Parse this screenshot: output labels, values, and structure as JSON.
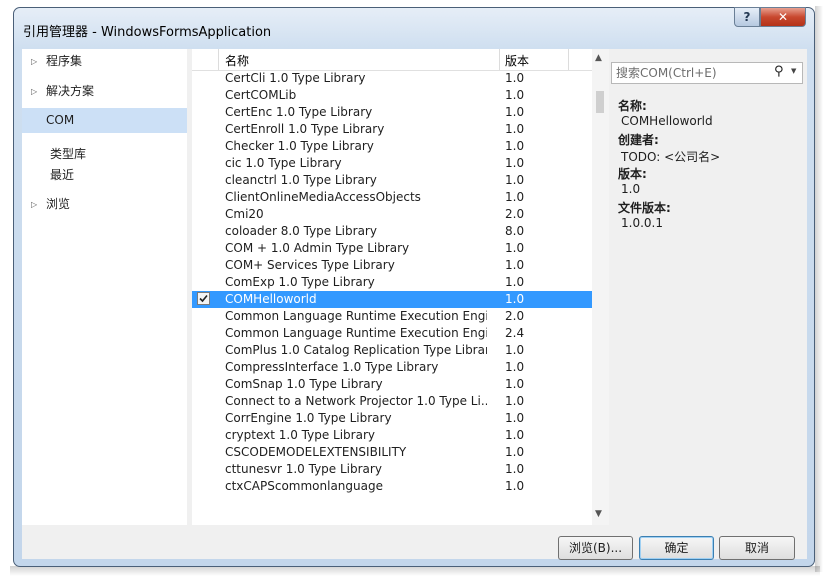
{
  "window": {
    "title": "引用管理器 - WindowsFormsApplication"
  },
  "titlebar": {
    "help_label": "?",
    "close_label": "✕"
  },
  "nav": {
    "items": [
      {
        "label": "程序集",
        "icon": "triangle-right-icon"
      },
      {
        "label": "解决方案",
        "icon": "triangle-right-icon"
      },
      {
        "label": "COM",
        "selected": true
      },
      {
        "label": "浏览",
        "icon": "triangle-right-icon"
      }
    ],
    "com_sub": [
      {
        "label": "类型库"
      },
      {
        "label": "最近"
      }
    ]
  },
  "list": {
    "columns": {
      "name": "名称",
      "version": "版本"
    },
    "rows": [
      {
        "name": "CertCli 1.0 Type Library",
        "version": "1.0"
      },
      {
        "name": "CertCOMLib",
        "version": "1.0"
      },
      {
        "name": "CertEnc 1.0 Type Library",
        "version": "1.0"
      },
      {
        "name": "CertEnroll 1.0 Type Library",
        "version": "1.0"
      },
      {
        "name": "Checker 1.0 Type Library",
        "version": "1.0"
      },
      {
        "name": "cic 1.0 Type Library",
        "version": "1.0"
      },
      {
        "name": "cleanctrl 1.0 Type Library",
        "version": "1.0"
      },
      {
        "name": "ClientOnlineMediaAccessObjects",
        "version": "1.0"
      },
      {
        "name": "Cmi20",
        "version": "2.0"
      },
      {
        "name": "coloader 8.0 Type Library",
        "version": "8.0"
      },
      {
        "name": "COM + 1.0 Admin Type Library",
        "version": "1.0"
      },
      {
        "name": "COM+ Services Type Library",
        "version": "1.0"
      },
      {
        "name": "ComExp 1.0 Type Library",
        "version": "1.0"
      },
      {
        "name": "COMHelloworld",
        "version": "1.0",
        "selected": true,
        "checked": true
      },
      {
        "name": "Common Language Runtime Execution Engi...",
        "version": "2.0"
      },
      {
        "name": "Common Language Runtime Execution Engi...",
        "version": "2.4"
      },
      {
        "name": "ComPlus 1.0 Catalog Replication Type Library",
        "version": "1.0"
      },
      {
        "name": "CompressInterface 1.0 Type Library",
        "version": "1.0"
      },
      {
        "name": "ComSnap 1.0 Type Library",
        "version": "1.0"
      },
      {
        "name": "Connect to a Network Projector 1.0 Type Li...",
        "version": "1.0"
      },
      {
        "name": "CorrEngine 1.0 Type Library",
        "version": "1.0"
      },
      {
        "name": "cryptext 1.0 Type Library",
        "version": "1.0"
      },
      {
        "name": "CSCODEMODELEXTENSIBILITY",
        "version": "1.0"
      },
      {
        "name": "cttunesvr 1.0 Type Library",
        "version": "1.0"
      },
      {
        "name": "ctxCAPScommonlanguage",
        "version": "1.0"
      }
    ]
  },
  "search": {
    "placeholder": "搜索COM(Ctrl+E)",
    "value": ""
  },
  "details": {
    "name_label": "名称:",
    "name_value": "COMHelloworld",
    "creator_label": "创建者:",
    "creator_value": "TODO: <公司名>",
    "version_label": "版本:",
    "version_value": "1.0",
    "file_version_label": "文件版本:",
    "file_version_value": "1.0.0.1"
  },
  "buttons": {
    "browse": "浏览(B)...",
    "ok": "确定",
    "cancel": "取消"
  }
}
